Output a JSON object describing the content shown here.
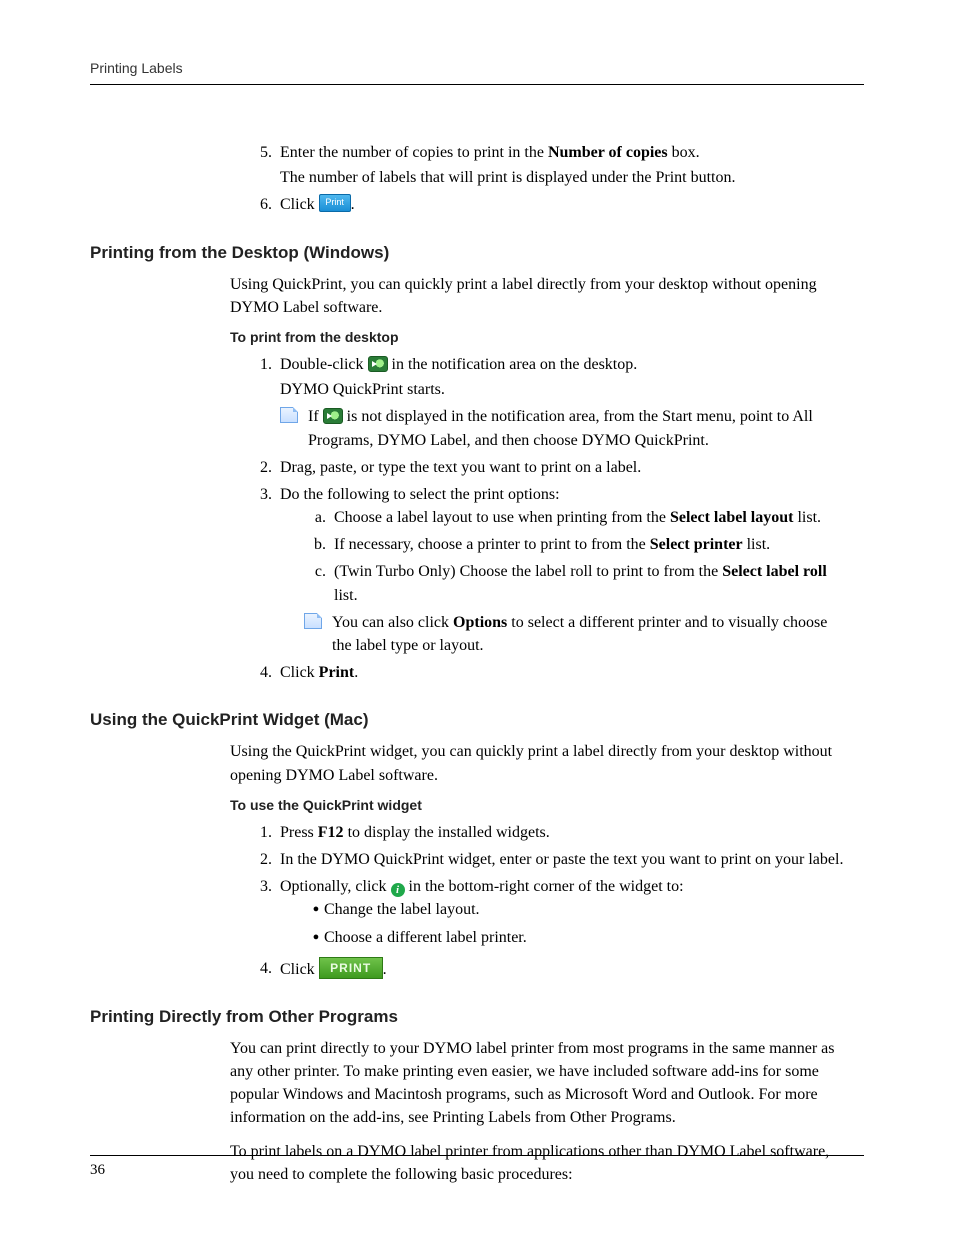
{
  "header": "Printing Labels",
  "page_number": "36",
  "top_steps": {
    "s5": {
      "num": "5.",
      "pre": "Enter the number of copies to print in the ",
      "bold": "Number of copies",
      "post": " box.",
      "line2": "The number of labels that will print is displayed under the Print button."
    },
    "s6": {
      "num": "6.",
      "pre": "Click ",
      "post": "."
    }
  },
  "sec1": {
    "title": "Printing from the Desktop (Windows)",
    "para": "Using QuickPrint, you can quickly print a label directly from your desktop without opening DYMO Label software.",
    "task": "To print from the desktop",
    "s1": {
      "num": "1.",
      "pre": "Double-click ",
      "post": " in the notification area on the desktop.",
      "line2": "DYMO QuickPrint starts."
    },
    "note": {
      "pre": "If ",
      "post": " is not displayed in the notification area, from the Start menu, point to All Programs, DYMO Label, and then choose DYMO QuickPrint."
    },
    "s2": {
      "num": "2.",
      "text": "Drag, paste, or type the text you want to print on a label."
    },
    "s3": {
      "num": "3.",
      "text": "Do the following to select the print options:"
    },
    "sa": {
      "num": "a.",
      "pre": "Choose a label layout to use when printing from the ",
      "bold": "Select label layout",
      "post": " list."
    },
    "sb": {
      "num": "b.",
      "pre": "If necessary, choose a printer to print to from the ",
      "bold": "Select printer",
      "post": " list."
    },
    "sc": {
      "num": "c.",
      "pre": "(Twin Turbo Only) Choose the label roll to print to from the ",
      "bold": "Select label roll",
      "post": " list."
    },
    "note2": {
      "pre": "You can also click ",
      "bold": "Options",
      "post": " to select a different printer and to visually choose the label type or layout."
    },
    "s4": {
      "num": "4.",
      "pre": "Click ",
      "bold": "Print",
      "post": "."
    }
  },
  "sec2": {
    "title": "Using the QuickPrint Widget (Mac)",
    "para": "Using the QuickPrint widget, you can quickly print a label directly from your desktop without opening DYMO Label software.",
    "task": "To use the QuickPrint widget",
    "s1": {
      "num": "1.",
      "pre": "Press ",
      "bold": "F12",
      "post": " to display the installed widgets."
    },
    "s2": {
      "num": "2.",
      "text": "In the DYMO QuickPrint widget, enter or paste the text you want to print on your label."
    },
    "s3": {
      "num": "3.",
      "pre": "Optionally, click ",
      "post": " in the bottom-right corner of the widget to:"
    },
    "b1": "Change the label layout.",
    "b2": "Choose a different label printer.",
    "s4": {
      "num": "4.",
      "pre": "Click ",
      "post": "."
    }
  },
  "sec3": {
    "title": "Printing Directly from Other Programs",
    "para1": "You can print directly to your DYMO label printer from most programs in the same manner as any other printer. To make printing even easier, we have included software add-ins for some popular Windows and Macintosh programs, such as Microsoft Word and Outlook. For more information on the add-ins, see Printing Labels from Other Programs.",
    "para2": "To print labels on a DYMO label printer from applications other than DYMO Label software, you need to complete the following basic procedures:"
  }
}
